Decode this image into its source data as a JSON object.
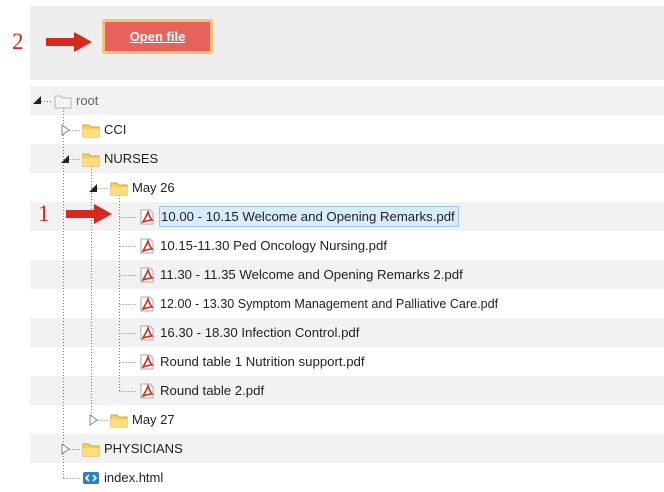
{
  "toolbar": {
    "open_file_label": "Open file"
  },
  "annotations": {
    "step1": "1",
    "step2": "2",
    "accent_color": "#d8281c"
  },
  "tree": {
    "root": "root",
    "cci": "CCI",
    "nurses": "NURSES",
    "may26": "May 26",
    "files": [
      "10.00 - 10.15 Welcome and Opening Remarks.pdf",
      "10.15-11.30 Ped Oncology Nursing.pdf",
      "11.30 - 11.35 Welcome and Opening Remarks 2.pdf",
      "12.00 - 13.30 Symptom Management and Palliative Care.pdf",
      "16.30 - 18.30 Infection Control.pdf",
      "Round table 1 Nutrition support.pdf",
      "Round table 2.pdf"
    ],
    "may27": "May 27",
    "physicians": "PHYSICIANS",
    "index": "index.html",
    "selected_file": "10.00 - 10.15 Welcome and Opening Remarks.pdf"
  }
}
